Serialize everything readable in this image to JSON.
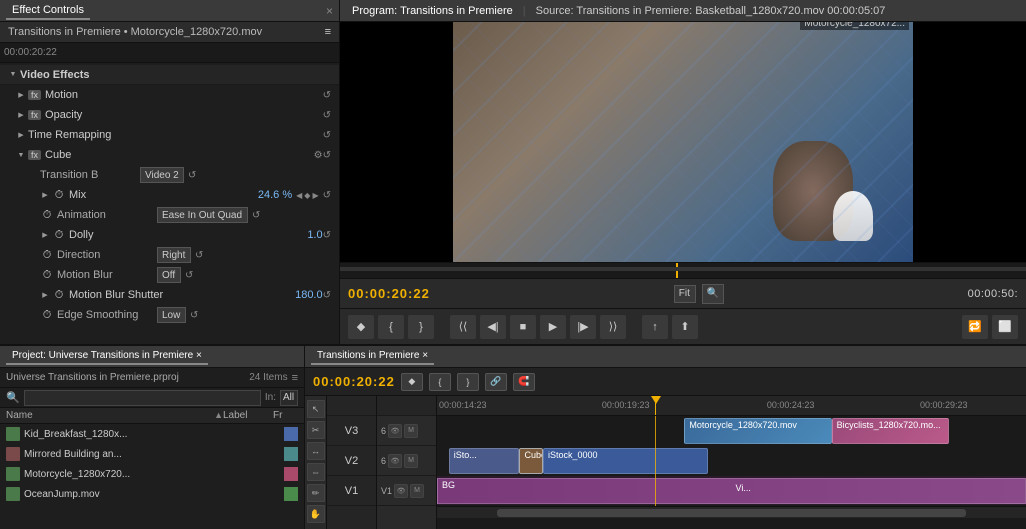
{
  "app": {
    "left_panel_tab": "Effect Controls",
    "left_panel_close": "×",
    "project_tab": "Effect Controls ×"
  },
  "effect_controls": {
    "title": "Transitions in Premiere • Motorcycle_1280x720.mov",
    "sections": {
      "video_effects_label": "Video Effects",
      "motion_label": "Motion",
      "opacity_label": "Opacity",
      "time_remap_label": "Time Remapping",
      "cube_label": "Cube",
      "transition_b_label": "Transition B",
      "transition_b_value": "Video 2",
      "mix_label": "Mix",
      "mix_value": "24.6 %",
      "animation_label": "Animation",
      "animation_value": "Ease In Out Quad",
      "dolly_label": "Dolly",
      "dolly_value": "1.0",
      "direction_label": "Direction",
      "direction_value": "Right",
      "motion_blur_label": "Motion Blur",
      "motion_blur_value": "Off",
      "motion_blur_shutter_label": "Motion Blur Shutter",
      "motion_blur_shutter_value": "180.0",
      "edge_smoothing_label": "Edge Smoothing",
      "edge_smoothing_value": "Low"
    },
    "timecode": "00:00:20:22"
  },
  "program_monitor": {
    "tab_label": "Program: Transitions in Premiere",
    "source_label": "Source: Transitions in Premiere: Basketball_1280x720.mov 00:00:05:07",
    "video_title": "Motorcycle_1280x72...",
    "timecode": "00:00:20:22",
    "timecode_right": "00:00:50:",
    "fit_label": "Fit",
    "buttons": {
      "in": "{",
      "out": "}",
      "prev": "◀◀",
      "step_back": "◀",
      "stop": "■",
      "play": "▶",
      "step_fwd": "▶",
      "next": "▶▶",
      "lift": "↑",
      "extract": "↑↑",
      "loop": "⟳",
      "safe": "⬜"
    }
  },
  "project_panel": {
    "tab_label": "Project: Universe Transitions in Premiere ×",
    "project_name": "Universe Transitions in Premiere.prproj",
    "item_count": "24 Items",
    "search_placeholder": "",
    "in_label": "In:",
    "in_value": "All",
    "columns": {
      "name": "Name",
      "label": "Label",
      "fr": "Fr"
    },
    "items": [
      {
        "name": "Kid_Breakfast_1280x...",
        "icon_type": "video",
        "color": "blue"
      },
      {
        "name": "Mirrored Building an...",
        "icon_type": "image",
        "color": "teal"
      },
      {
        "name": "Motorcycle_1280x720...",
        "icon_type": "video",
        "color": "pink"
      },
      {
        "name": "OceanJump.mov",
        "icon_type": "video",
        "color": "green"
      }
    ]
  },
  "timeline_panel": {
    "tab_label": "Transitions in Premiere ×",
    "timecode": "00:00:20:22",
    "ruler_times": [
      "00:00:14:23",
      "00:00:19:23",
      "00:00:24:23",
      "00:00:29:23"
    ],
    "tracks": {
      "v3_label": "V3",
      "v2_label": "V2",
      "v1_label": "V1"
    },
    "clips": {
      "motorcycle": "Motorcycle_1280x720.mov",
      "bicyclists": "Bicyclists_1280x720.mo...",
      "istock": "iStock_0000",
      "cube_label": "Cube",
      "istock_short": "iSto...",
      "bg": "BG",
      "v1": "Vi..."
    }
  }
}
